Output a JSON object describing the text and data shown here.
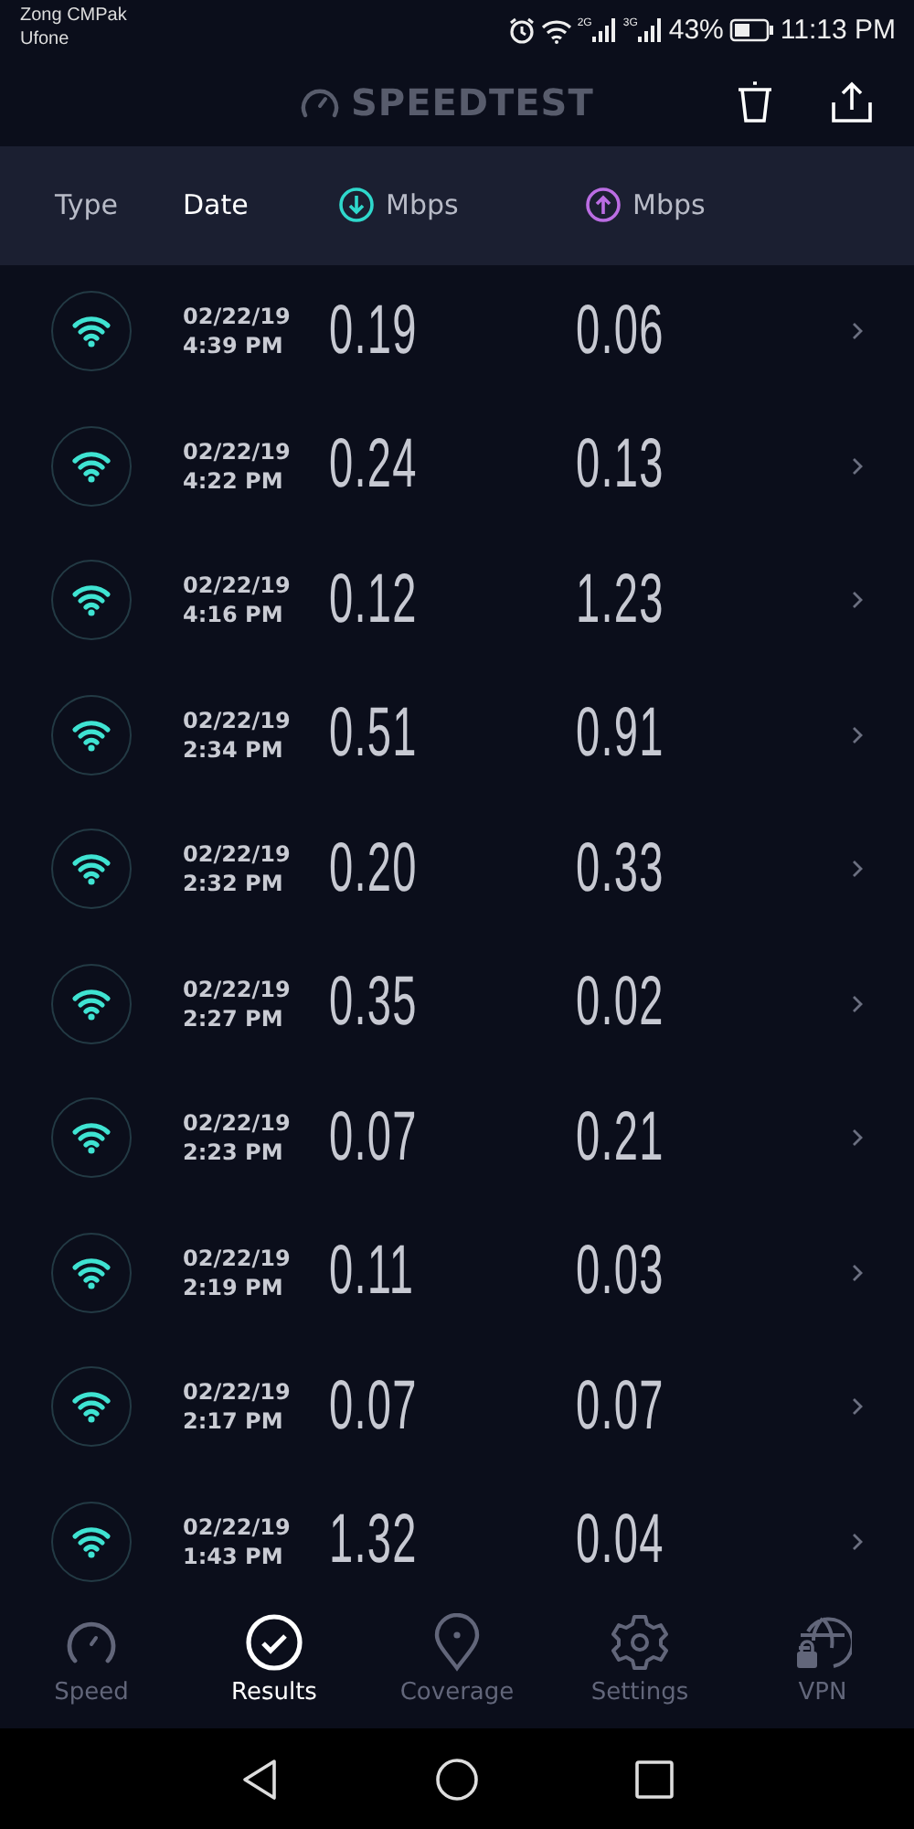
{
  "status_bar": {
    "carriers": [
      "Zong CMPak",
      "Ufone"
    ],
    "networks": [
      "2G",
      "3G"
    ],
    "battery": "43%",
    "time": "11:13 PM"
  },
  "app_bar": {
    "title": "SPEEDTEST"
  },
  "columns": [
    {
      "kind": "type",
      "label": "Type"
    },
    {
      "kind": "date",
      "label": "Date"
    },
    {
      "kind": "download",
      "label": "Mbps"
    },
    {
      "kind": "upload",
      "label": "Mbps"
    }
  ],
  "results": [
    {
      "kind": "wifi",
      "date": "02/22/19",
      "time": "4:39 PM",
      "download": "0.19",
      "upload": "0.06"
    },
    {
      "kind": "wifi",
      "date": "02/22/19",
      "time": "4:22 PM",
      "download": "0.24",
      "upload": "0.13"
    },
    {
      "kind": "wifi",
      "date": "02/22/19",
      "time": "4:16 PM",
      "download": "0.12",
      "upload": "1.23"
    },
    {
      "kind": "wifi",
      "date": "02/22/19",
      "time": "2:34 PM",
      "download": "0.51",
      "upload": "0.91"
    },
    {
      "kind": "wifi",
      "date": "02/22/19",
      "time": "2:32 PM",
      "download": "0.20",
      "upload": "0.33"
    },
    {
      "kind": "wifi",
      "date": "02/22/19",
      "time": "2:27 PM",
      "download": "0.35",
      "upload": "0.02"
    },
    {
      "kind": "wifi",
      "date": "02/22/19",
      "time": "2:23 PM",
      "download": "0.07",
      "upload": "0.21"
    },
    {
      "kind": "wifi",
      "date": "02/22/19",
      "time": "2:19 PM",
      "download": "0.11",
      "upload": "0.03"
    },
    {
      "kind": "wifi",
      "date": "02/22/19",
      "time": "2:17 PM",
      "download": "0.07",
      "upload": "0.07"
    },
    {
      "kind": "wifi",
      "date": "02/22/19",
      "time": "1:43 PM",
      "download": "1.32",
      "upload": "0.04"
    }
  ],
  "tabs": [
    {
      "kind": "speed",
      "label": "Speed",
      "selected": false
    },
    {
      "kind": "results",
      "label": "Results",
      "selected": true
    },
    {
      "kind": "coverage",
      "label": "Coverage",
      "selected": false
    },
    {
      "kind": "settings",
      "label": "Settings",
      "selected": false
    },
    {
      "kind": "vpn",
      "label": "VPN",
      "selected": false
    }
  ]
}
